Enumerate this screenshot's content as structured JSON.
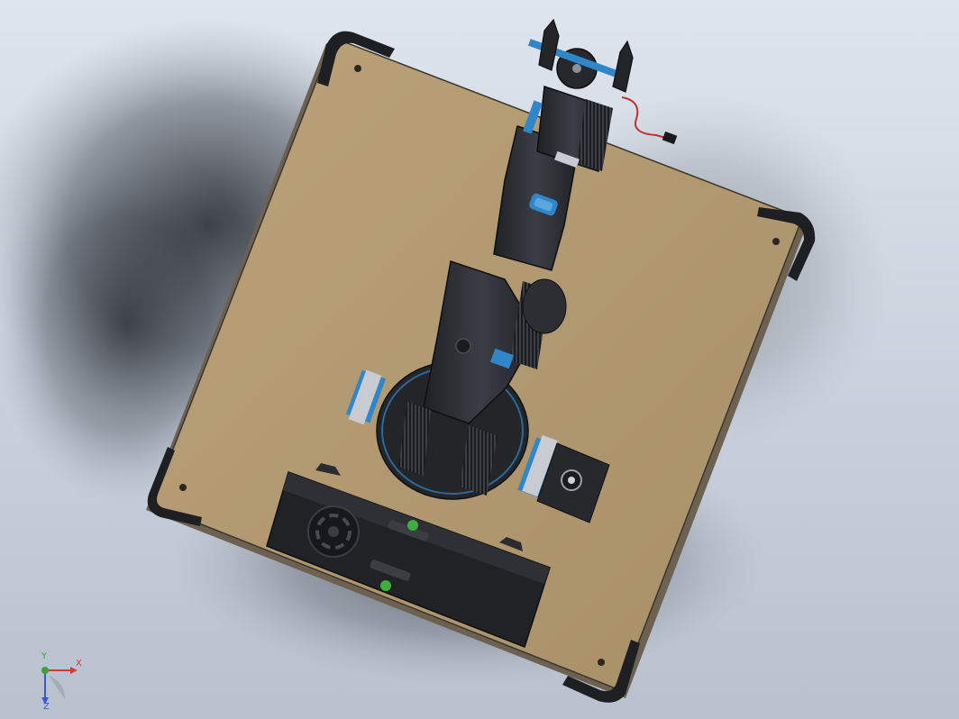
{
  "viewport": {
    "background_top": "#dfe5ee",
    "background_bottom": "#b8c1cd",
    "base_plate_color": "#b29a73",
    "arm_color": "#2b2d31",
    "accent_color": "#2f86c9",
    "connector_green": "#3fae3f",
    "cable_red": "#c0302a"
  },
  "triad": {
    "x_label": "X",
    "y_label": "Y",
    "z_label": "Z",
    "x_color": "#d23a3a",
    "y_color": "#3aa03a",
    "z_color": "#3a5ad2"
  }
}
